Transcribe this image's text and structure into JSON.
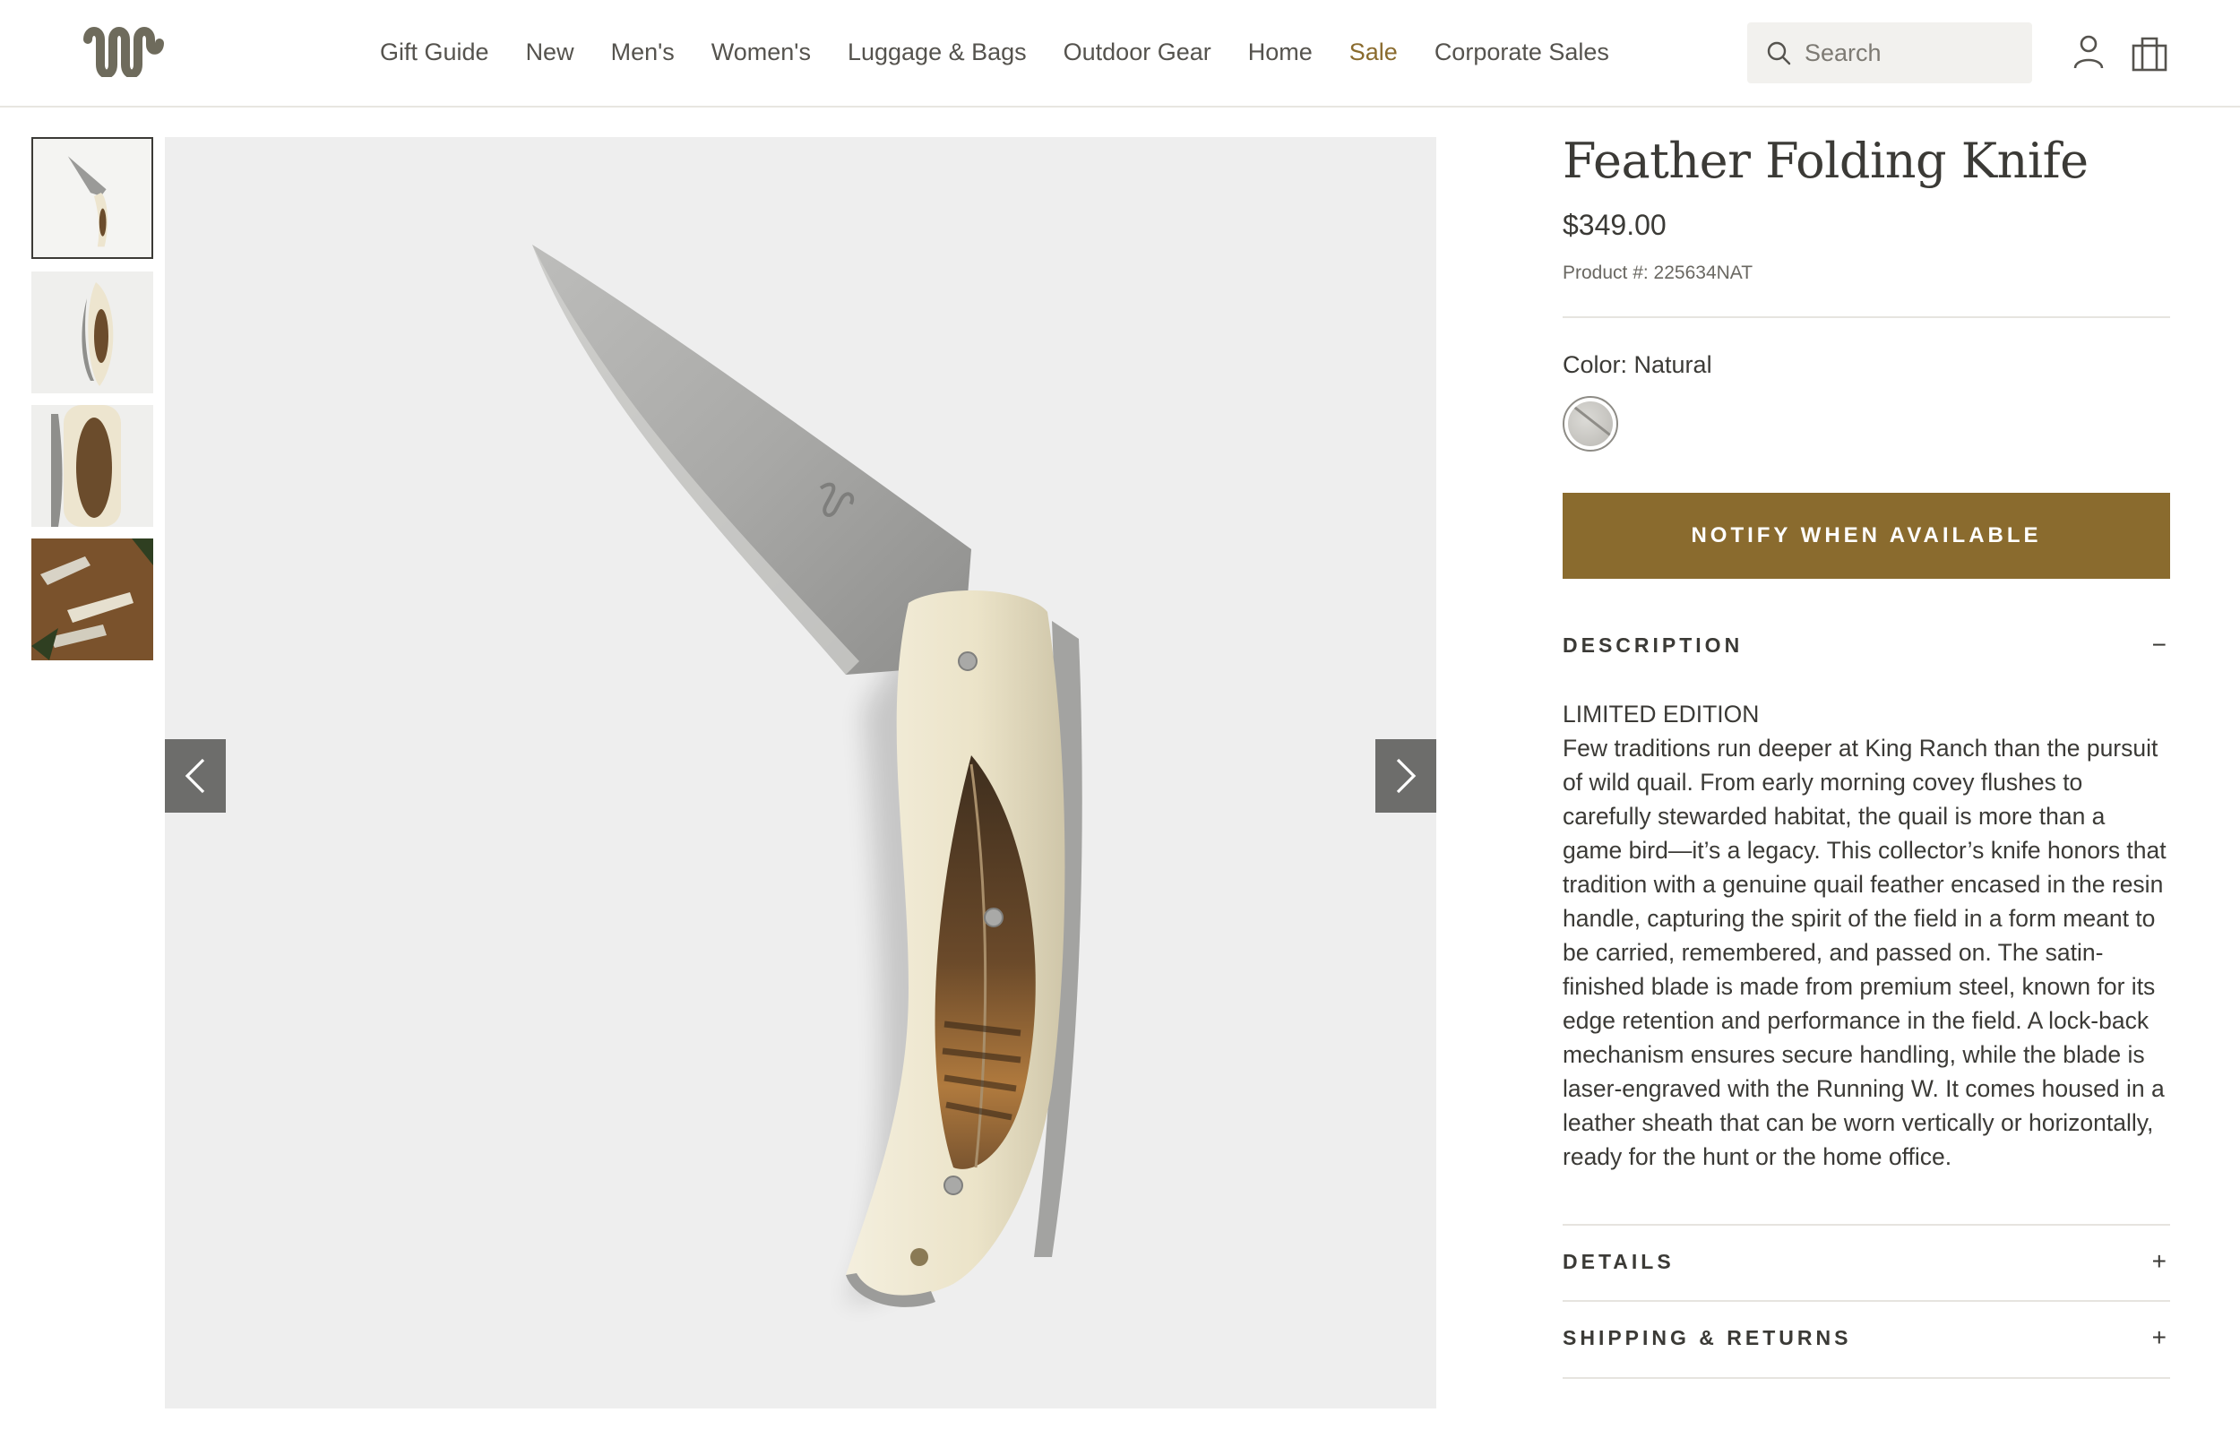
{
  "header": {
    "nav": [
      {
        "label": "Gift Guide",
        "accent": false
      },
      {
        "label": "New",
        "accent": false
      },
      {
        "label": "Men's",
        "accent": false
      },
      {
        "label": "Women's",
        "accent": false
      },
      {
        "label": "Luggage & Bags",
        "accent": false
      },
      {
        "label": "Outdoor Gear",
        "accent": false
      },
      {
        "label": "Home",
        "accent": false
      },
      {
        "label": "Sale",
        "accent": true
      },
      {
        "label": "Corporate Sales",
        "accent": false
      }
    ],
    "search_placeholder": "Search",
    "icons": [
      "running-w-logo",
      "search-icon",
      "account-icon",
      "shopping-bag-icon"
    ]
  },
  "gallery": {
    "thumbnails": [
      "knife-open",
      "knife-closed-feather",
      "knife-handle-closeup",
      "knives-lifestyle"
    ],
    "active_index": 0,
    "arrows": [
      "chevron-left-icon",
      "chevron-right-icon"
    ]
  },
  "product": {
    "title": "Feather Folding Knife",
    "price": "$349.00",
    "sku": "Product #: 225634NAT",
    "color_label": "Color: Natural",
    "notify_label": "NOTIFY WHEN AVAILABLE",
    "description_heading": "DESCRIPTION",
    "description_toggle": "−",
    "description_edition": "LIMITED EDITION",
    "description_text": "Few traditions run deeper at King Ranch than the pursuit of wild quail. From early morning covey flushes to carefully stewarded habitat, the quail is more than a game bird—it’s a legacy. This collector’s knife honors that tradition with a genuine quail feather encased in the resin handle, capturing the spirit of the field in a form meant to be carried, remembered, and passed on. The satin-finished blade is made from premium steel, known for its edge retention and performance in the field. A lock-back mechanism ensures secure handling, while the blade is laser-engraved with the Running W. It comes housed in a leather sheath that can be worn vertically or horizontally, ready for the hunt or the home office.",
    "details_heading": "DETAILS",
    "details_toggle": "+",
    "shipping_heading": "SHIPPING & RETURNS",
    "shipping_toggle": "+"
  },
  "colors": {
    "accent": "#8a6b2e",
    "text": "#3b3a36",
    "image_bg": "#eeeeee",
    "arrow_bg": "#6d6d6b"
  }
}
